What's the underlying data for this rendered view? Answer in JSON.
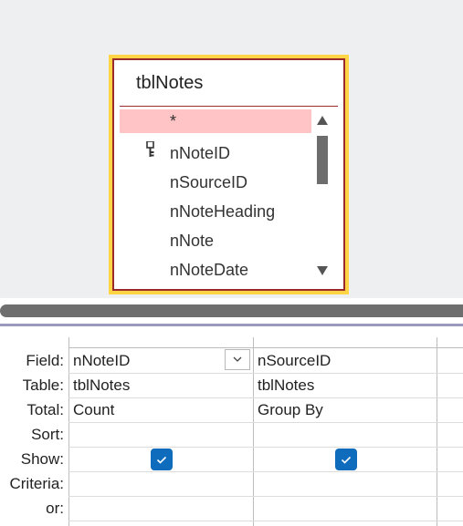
{
  "table": {
    "title": "tblNotes",
    "fields": [
      {
        "name": "*",
        "selected": true,
        "primary_key": false
      },
      {
        "name": "nNoteID",
        "selected": false,
        "primary_key": true
      },
      {
        "name": "nSourceID",
        "selected": false,
        "primary_key": false
      },
      {
        "name": "nNoteHeading",
        "selected": false,
        "primary_key": false
      },
      {
        "name": "nNote",
        "selected": false,
        "primary_key": false
      },
      {
        "name": "nNoteDate",
        "selected": false,
        "primary_key": false
      }
    ]
  },
  "grid": {
    "row_labels": {
      "field": "Field:",
      "table": "Table:",
      "total": "Total:",
      "sort": "Sort:",
      "show": "Show:",
      "criteria": "Criteria:",
      "or": "or:"
    },
    "columns": [
      {
        "field": "nNoteID",
        "table": "tblNotes",
        "total": "Count",
        "sort": "",
        "show": true,
        "criteria": "",
        "or": ""
      },
      {
        "field": "nSourceID",
        "table": "tblNotes",
        "total": "Group By",
        "sort": "",
        "show": true,
        "criteria": "",
        "or": ""
      }
    ]
  },
  "colors": {
    "table_highlight": "#ffd545",
    "table_border": "#9b2b2b",
    "selected_row": "#ffc4c6",
    "checkbox": "#0f6cbd"
  }
}
